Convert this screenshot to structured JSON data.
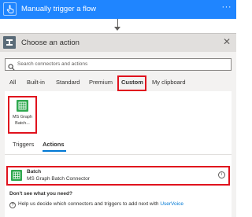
{
  "trigger": {
    "title": "Manually trigger a flow",
    "more": "···",
    "icon": "hand-pointer-icon",
    "color": "#1f85ff"
  },
  "panel": {
    "title": "Choose an action",
    "close": "✕",
    "icon": "choose-action-icon"
  },
  "search": {
    "placeholder": "Search connectors and actions"
  },
  "tabs": [
    {
      "label": "All"
    },
    {
      "label": "Built-in"
    },
    {
      "label": "Standard"
    },
    {
      "label": "Premium"
    },
    {
      "label": "Custom",
      "selected": true
    },
    {
      "label": "My clipboard"
    }
  ],
  "connector_tile": {
    "label_line1": "MS Graph",
    "label_line2": "Batch...",
    "icon": "ms-graph-batch-icon",
    "color": "#2fa84f"
  },
  "subtabs": [
    {
      "label": "Triggers"
    },
    {
      "label": "Actions",
      "selected": true
    }
  ],
  "action": {
    "title": "Batch",
    "subtitle": "MS Graph Batch Connector",
    "info": "i"
  },
  "help": {
    "heading": "Don't see what you need?",
    "icon": "?",
    "text": "Help us decide which connectors and triggers to add next with",
    "link": "UserVoice"
  },
  "highlight_color": "#e0121d",
  "accent_color": "#0078d4"
}
